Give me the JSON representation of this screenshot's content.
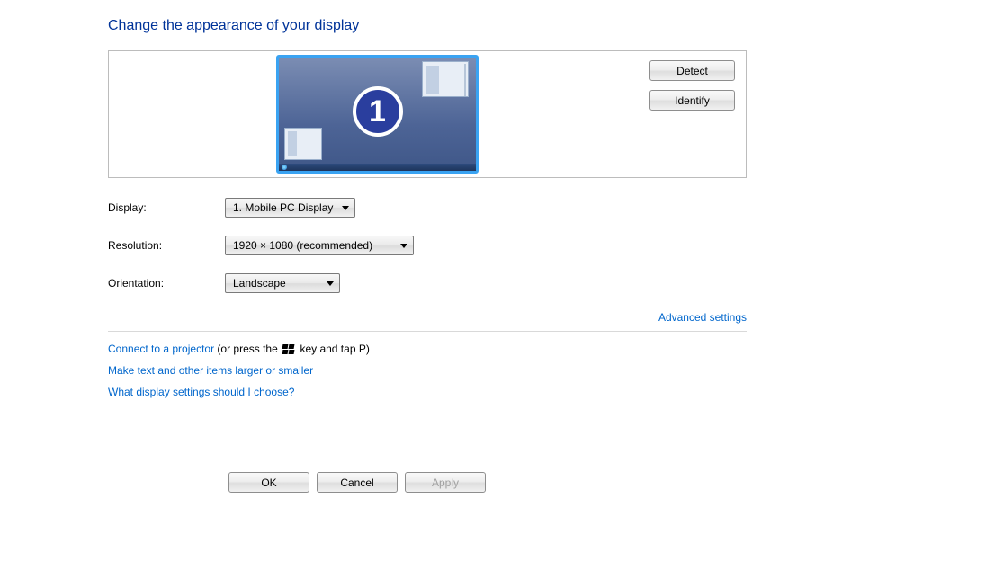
{
  "heading": "Change the appearance of your display",
  "monitor": {
    "number": "1"
  },
  "panel_buttons": {
    "detect": "Detect",
    "identify": "Identify"
  },
  "rows": {
    "display_label": "Display:",
    "display_value": "1. Mobile PC Display",
    "resolution_label": "Resolution:",
    "resolution_value": "1920 × 1080 (recommended)",
    "orientation_label": "Orientation:",
    "orientation_value": "Landscape"
  },
  "links": {
    "advanced": "Advanced settings",
    "projector": "Connect to a projector",
    "projector_suffix_before": " (or press the ",
    "projector_suffix_after": " key and tap P)",
    "text_size": "Make text and other items larger or smaller",
    "help": "What display settings should I choose?"
  },
  "footer": {
    "ok": "OK",
    "cancel": "Cancel",
    "apply": "Apply"
  }
}
